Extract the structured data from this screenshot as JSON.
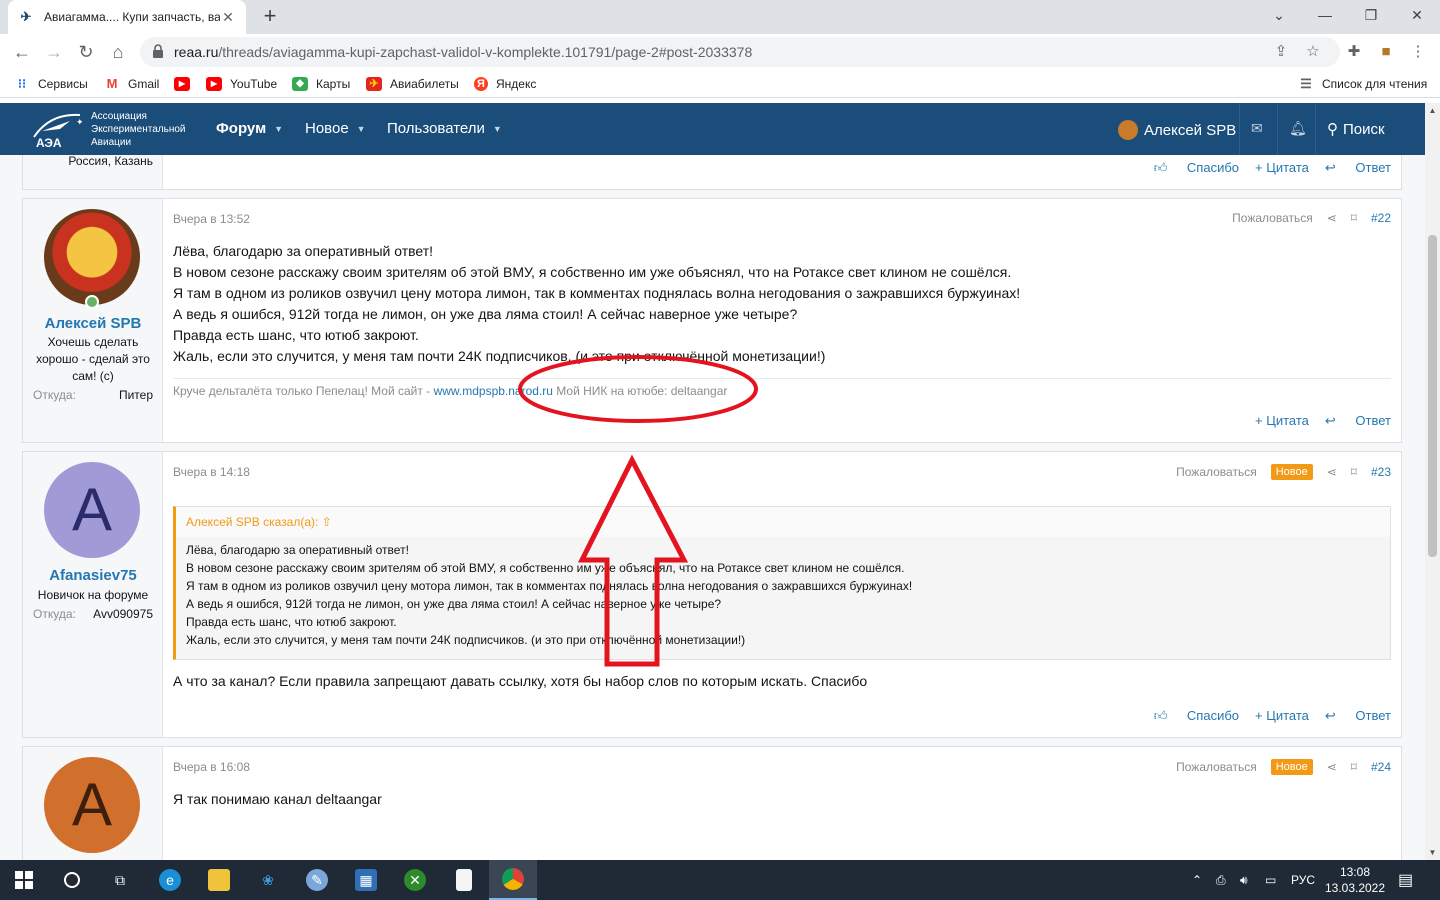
{
  "browser": {
    "tab_title": "Авиагамма.... Купи запчасть, ва",
    "url_host": "reaa.ru",
    "url_path": "/threads/aviagamma-kupi-zapchast-validol-v-komplekte.101791/page-2#post-2033378",
    "bookmarks": [
      "Сервисы",
      "Gmail",
      "YouTube",
      "Карты",
      "Авиабилеты",
      "Яндекс"
    ],
    "reading_list": "Список для чтения"
  },
  "site": {
    "logo_text": [
      "Ассоциация",
      "Экспериментальной",
      "Авиации"
    ],
    "logo_abbr": "АЭА",
    "nav": [
      "Форум",
      "Новое",
      "Пользователи"
    ],
    "user": "Алексей SPB",
    "search": "Поиск"
  },
  "prev_post": {
    "location_tail": "Россия, Казань",
    "actions": [
      "Спасибо",
      "+ Цитата",
      "Ответ"
    ]
  },
  "post22": {
    "date": "Вчера в 13:52",
    "report": "Пожаловаться",
    "num": "#22",
    "author": "Алексей SPB",
    "author_title": "Хочешь сделать хорошо - сделай это сам! (c)",
    "from_label": "Откуда:",
    "from_value": "Питер",
    "lines": [
      "Лёва, благодарю за оперативный ответ!",
      "В новом сезоне расскажу своим зрителям об этой ВМУ, я собственно им уже объяснял, что на Ротаксе свет клином не сошёлся.",
      "Я там в одном из роликов озвучил цену мотора лимон, так в комментах поднялась волна негодования о зажравшихся буржуинах!",
      "А ведь я ошибся, 912й тогда не лимон, он уже два ляма стоил! А сейчас наверное уже четыре?",
      "Правда есть шанс, что ютюб закроют.",
      "Жаль, если это случится, у меня там почти 24К подписчиков. (и это при отключённой монетизации!)"
    ],
    "sig_prefix": "Круче дельталёта только Пепелац! Мой сайт - ",
    "sig_link": "www.mdpspb.narod.ru",
    "sig_suffix": " Мой НИК на ютюбе: deltaangar",
    "actions": [
      "+ Цитата",
      "Ответ"
    ]
  },
  "post23": {
    "date": "Вчера в 14:18",
    "report": "Пожаловаться",
    "badge": "Новое",
    "num": "#23",
    "avatar_letter": "A",
    "author": "Afanasiev75",
    "author_title": "Новичок на форуме",
    "from_label": "Откуда:",
    "from_value": "Avv090975",
    "quote_head": "Алексей SPB сказал(а):",
    "quote_lines": [
      "Лёва, благодарю за оперативный ответ!",
      "В новом сезоне расскажу своим зрителям об этой ВМУ, я собственно им уже объяснял, что на Ротаксе свет клином не сошёлся.",
      "Я там в одном из роликов озвучил цену мотора лимон, так в комментах поднялась волна негодования о зажравшихся буржуинах!",
      "А ведь я ошибся, 912й тогда не лимон, он уже два ляма стоил! А сейчас наверное уже четыре?",
      "Правда есть шанс, что ютюб закроют.",
      "Жаль, если это случится, у меня там почти 24К подписчиков. (и это при отключённой монетизации!)"
    ],
    "message": "А что за канал? Если правила запрещают давать ссылку, хотя бы набор слов по которым искать. Спасибо",
    "actions": [
      "Спасибо",
      "+ Цитата",
      "Ответ"
    ]
  },
  "post24": {
    "date": "Вчера в 16:08",
    "report": "Пожаловаться",
    "badge": "Новое",
    "num": "#24",
    "avatar_letter": "A",
    "message": "Я так понимаю канал deltaangar"
  },
  "taskbar": {
    "lang": "РУС",
    "time": "13:08",
    "date": "13.03.2022"
  },
  "colors": {
    "header": "#1b4d7a",
    "link": "#2577b1",
    "badge": "#f29a16",
    "annotation": "#e3141f"
  }
}
